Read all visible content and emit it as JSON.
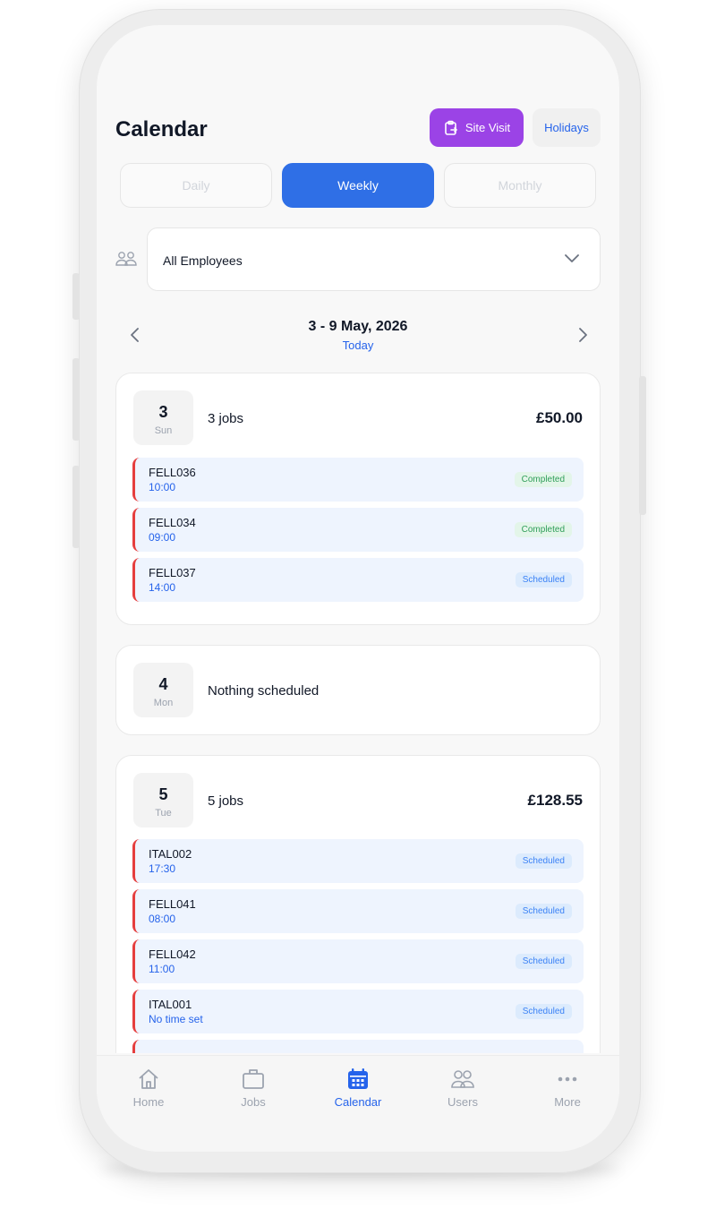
{
  "header": {
    "title": "Calendar",
    "site_visit_label": "Site Visit",
    "holidays_label": "Holidays"
  },
  "view_tabs": [
    {
      "label": "Daily",
      "active": false
    },
    {
      "label": "Weekly",
      "active": true
    },
    {
      "label": "Monthly",
      "active": false
    }
  ],
  "employee_filter": {
    "selected": "All Employees"
  },
  "date_nav": {
    "range": "3 - 9 May, 2026",
    "today_label": "Today"
  },
  "days": [
    {
      "num": "3",
      "name": "Sun",
      "summary": "3 jobs",
      "total": "£50.00",
      "jobs": [
        {
          "code": "FELL036",
          "time": "10:00",
          "status": "Completed"
        },
        {
          "code": "FELL034",
          "time": "09:00",
          "status": "Completed"
        },
        {
          "code": "FELL037",
          "time": "14:00",
          "status": "Scheduled"
        }
      ]
    },
    {
      "num": "4",
      "name": "Mon",
      "summary": "Nothing scheduled",
      "total": "",
      "jobs": []
    },
    {
      "num": "5",
      "name": "Tue",
      "summary": "5 jobs",
      "total": "£128.55",
      "jobs": [
        {
          "code": "ITAL002",
          "time": "17:30",
          "status": "Scheduled"
        },
        {
          "code": "FELL041",
          "time": "08:00",
          "status": "Scheduled"
        },
        {
          "code": "FELL042",
          "time": "11:00",
          "status": "Scheduled"
        },
        {
          "code": "ITAL001",
          "time": "No time set",
          "status": "Scheduled"
        }
      ]
    }
  ],
  "bottom_nav": [
    {
      "label": "Home",
      "icon": "home-icon",
      "active": false
    },
    {
      "label": "Jobs",
      "icon": "briefcase-icon",
      "active": false
    },
    {
      "label": "Calendar",
      "icon": "calendar-icon",
      "active": true
    },
    {
      "label": "Users",
      "icon": "users-icon",
      "active": false
    },
    {
      "label": "More",
      "icon": "more-icon",
      "active": false
    }
  ],
  "colors": {
    "accent": "#2f6fe6",
    "site_visit": "#9b43e6",
    "job_border": "#e53e3e",
    "completed": "#2f9e58",
    "scheduled": "#3b82f6"
  }
}
